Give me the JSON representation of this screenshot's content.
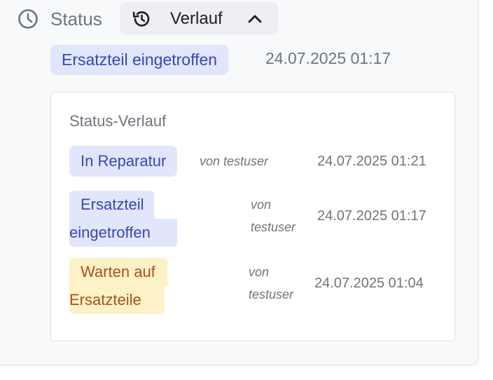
{
  "header": {
    "status_label": "Status",
    "toggle_label": "Verlauf"
  },
  "current_status": {
    "label": "Ersatzteil eingetroffen",
    "timestamp": "24.07.2025 01:17"
  },
  "history": {
    "title": "Status-Verlauf",
    "entries": [
      {
        "status": "In Reparatur",
        "by": "von testuser",
        "timestamp": "24.07.2025 01:21",
        "color": "#3a45b6"
      },
      {
        "status_line1": "Ersatzteil",
        "status_line2": "eingetroffen",
        "by_line1": "von",
        "by_line2": "testuser",
        "timestamp": "24.07.2025 01:17",
        "color": "#3a45b6"
      },
      {
        "status_line1": "Warten auf",
        "status_line2": "Ersatzteile",
        "by_line1": "von",
        "by_line2": "testuser",
        "timestamp": "24.07.2025 01:04",
        "color": "#a8521c"
      }
    ]
  },
  "icons": [
    "clock-icon",
    "history-icon",
    "chevron-up-icon"
  ],
  "colors": {
    "badge_blue_bg": "#e1e6fb",
    "badge_blue_text": "#3a45b6",
    "badge_amber_bg": "#fdf1c7",
    "badge_amber_text": "#a8521c"
  }
}
